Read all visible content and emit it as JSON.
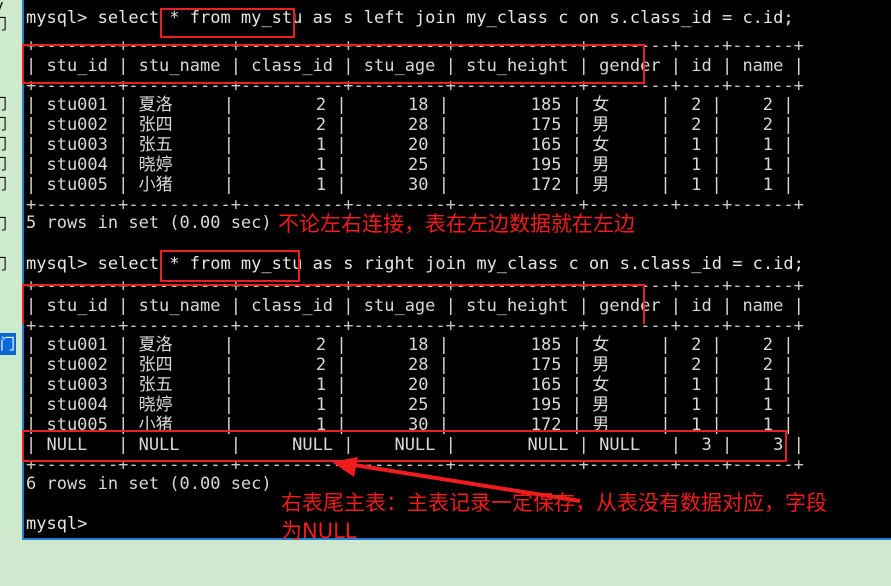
{
  "window": {
    "kind": "mysql-terminal",
    "background_color": "#000000",
    "border_color": "#1f7fd0",
    "editor_background_color": "#cfe8cf",
    "annotation_color": "#f01c1c"
  },
  "editor_gutter": {
    "partial_text": "门",
    "lines": [
      "门",
      "门",
      "门",
      "门",
      "门",
      "门",
      "门",
      "门",
      "门"
    ],
    "selected_line_text": "门",
    "top_fragment": "y"
  },
  "terminal": {
    "lines": [
      {
        "id": "cmd1",
        "text": "mysql> select * from my_stu as s left join my_class c on s.class_id = c.id;"
      },
      {
        "id": "t1-top",
        "text": "+--------+----------+----------+---------+------------+--------+----+------+"
      },
      {
        "id": "t1-head",
        "text": "| stu_id | stu_name | class_id | stu_age | stu_height | gender | id | name |"
      },
      {
        "id": "t1-head-sep",
        "text": "+--------+----------+----------+---------+------------+--------+----+------+"
      },
      {
        "id": "t1-r1",
        "text": "| stu001 | 夏洛     |        2 |      18 |        185 | 女     |  2 |    2 |"
      },
      {
        "id": "t1-r2",
        "text": "| stu002 | 张四     |        2 |      28 |        175 | 男     |  2 |    2 |"
      },
      {
        "id": "t1-r3",
        "text": "| stu003 | 张五     |        1 |      20 |        165 | 女     |  1 |    1 |"
      },
      {
        "id": "t1-r4",
        "text": "| stu004 | 晓婷     |        1 |      25 |        195 | 男     |  1 |    1 |"
      },
      {
        "id": "t1-r5",
        "text": "| stu005 | 小猪     |        1 |      30 |        172 | 男     |  1 |    1 |"
      },
      {
        "id": "t1-bot",
        "text": "+--------+----------+----------+---------+------------+--------+----+------+"
      },
      {
        "id": "res1",
        "text": "5 rows in set (0.00 sec)"
      },
      {
        "id": "blank1",
        "text": ""
      },
      {
        "id": "cmd2",
        "text": "mysql> select * from my_stu as s right join my_class c on s.class_id = c.id;"
      },
      {
        "id": "t2-top",
        "text": "+--------+----------+----------+---------+------------+--------+----+------+"
      },
      {
        "id": "t2-head",
        "text": "| stu_id | stu_name | class_id | stu_age | stu_height | gender | id | name |"
      },
      {
        "id": "t2-head-sep",
        "text": "+--------+----------+----------+---------+------------+--------+----+------+"
      },
      {
        "id": "t2-r1",
        "text": "| stu001 | 夏洛     |        2 |      18 |        185 | 女     |  2 |    2 |"
      },
      {
        "id": "t2-r2",
        "text": "| stu002 | 张四     |        2 |      28 |        175 | 男     |  2 |    2 |"
      },
      {
        "id": "t2-r3",
        "text": "| stu003 | 张五     |        1 |      20 |        165 | 女     |  1 |    1 |"
      },
      {
        "id": "t2-r4",
        "text": "| stu004 | 晓婷     |        1 |      25 |        195 | 男     |  1 |    1 |"
      },
      {
        "id": "t2-r5",
        "text": "| stu005 | 小猪     |        1 |      30 |        172 | 男     |  1 |    1 |"
      },
      {
        "id": "t2-r6",
        "text": "| NULL   | NULL     |     NULL |    NULL |       NULL | NULL   |  3 |    3 |"
      },
      {
        "id": "t2-bot",
        "text": "+--------+----------+----------+---------+------------+--------+----+------+"
      },
      {
        "id": "res2",
        "text": "6 rows in set (0.00 sec)"
      },
      {
        "id": "blank2",
        "text": ""
      },
      {
        "id": "prompt",
        "text": "mysql>"
      }
    ]
  },
  "queries": {
    "query_1": "mysql> select * from my_stu as s left join my_class c on s.class_id = c.id;",
    "query_2": "mysql> select * from my_stu as s right join my_class c on s.class_id = c.id;",
    "result_1": "5 rows in set (0.00 sec)",
    "result_2": "6 rows in set (0.00 sec)",
    "final_prompt": "mysql>"
  },
  "result_table": {
    "columns": [
      "stu_id",
      "stu_name",
      "class_id",
      "stu_age",
      "stu_height",
      "gender",
      "id",
      "name"
    ],
    "left_join_rows": [
      [
        "stu001",
        "夏洛",
        "2",
        "18",
        "185",
        "女",
        "2",
        "2"
      ],
      [
        "stu002",
        "张四",
        "2",
        "28",
        "175",
        "男",
        "2",
        "2"
      ],
      [
        "stu003",
        "张五",
        "1",
        "20",
        "165",
        "女",
        "1",
        "1"
      ],
      [
        "stu004",
        "晓婷",
        "1",
        "25",
        "195",
        "男",
        "1",
        "1"
      ],
      [
        "stu005",
        "小猪",
        "1",
        "30",
        "172",
        "男",
        "1",
        "1"
      ]
    ],
    "right_join_rows": [
      [
        "stu001",
        "夏洛",
        "2",
        "18",
        "185",
        "女",
        "2",
        "2"
      ],
      [
        "stu002",
        "张四",
        "2",
        "28",
        "175",
        "男",
        "2",
        "2"
      ],
      [
        "stu003",
        "张五",
        "1",
        "20",
        "165",
        "女",
        "1",
        "1"
      ],
      [
        "stu004",
        "晓婷",
        "1",
        "25",
        "195",
        "男",
        "1",
        "1"
      ],
      [
        "stu005",
        "小猪",
        "1",
        "30",
        "172",
        "男",
        "1",
        "1"
      ],
      [
        "NULL",
        "NULL",
        "NULL",
        "NULL",
        "NULL",
        "NULL",
        "3",
        "3"
      ]
    ]
  },
  "annotations": {
    "note_middle": "不论左右连接，表在左边数据就在左边",
    "note_bottom_line1": "右表尾主表：主表记录一定保存，从表没有数据对应，字段",
    "note_bottom_line2": "为NULL",
    "highlight_table_name_1": "my_stu",
    "highlight_table_name_2": "my_stu",
    "highlight_columns_label": "stu_id .. gender"
  }
}
